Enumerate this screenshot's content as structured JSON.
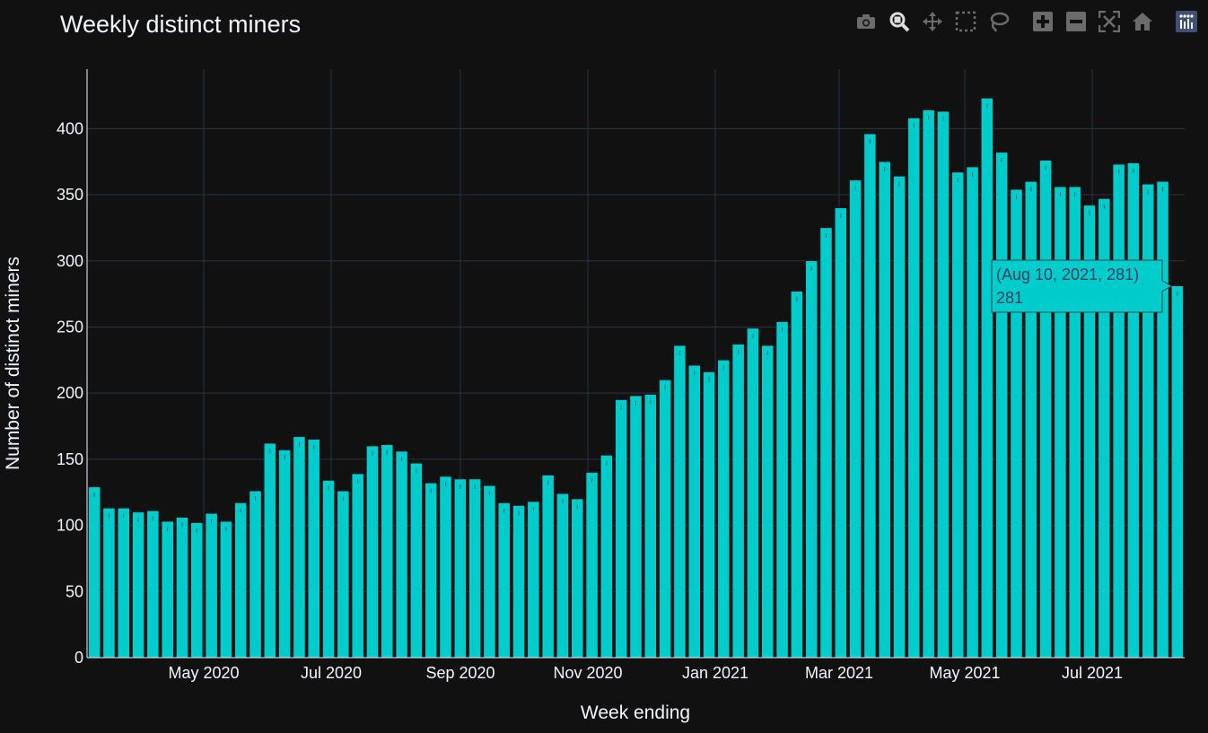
{
  "chart_data": {
    "type": "bar",
    "title": "Weekly distinct miners",
    "xlabel": "Week ending",
    "ylabel": "Number of distinct miners",
    "x_tick_labels": [
      "May 2020",
      "Jul 2020",
      "Sep 2020",
      "Nov 2020",
      "Jan 2021",
      "Mar 2021",
      "May 2021",
      "Jul 2021"
    ],
    "y_tick_labels": [
      "0",
      "50",
      "100",
      "150",
      "200",
      "250",
      "300",
      "350",
      "400"
    ],
    "ylim": [
      0,
      445
    ],
    "grid": true,
    "bar_color": "#00cccc",
    "values": [
      129,
      113,
      113,
      110,
      111,
      103,
      106,
      102,
      109,
      103,
      117,
      126,
      162,
      157,
      167,
      165,
      134,
      126,
      139,
      160,
      161,
      156,
      147,
      132,
      137,
      135,
      135,
      130,
      117,
      115,
      118,
      138,
      124,
      120,
      140,
      153,
      195,
      198,
      199,
      210,
      236,
      221,
      216,
      225,
      237,
      249,
      236,
      254,
      277,
      300,
      325,
      340,
      361,
      396,
      375,
      364,
      408,
      414,
      413,
      367,
      371,
      423,
      382,
      354,
      360,
      376,
      356,
      356,
      342,
      347,
      373,
      374,
      358,
      360,
      281
    ],
    "hover": {
      "label": "(Aug 10, 2021, 281)",
      "value": "281"
    }
  },
  "modebar": {
    "colors": {
      "icon": "#6b6b6b",
      "active": "#dddddd",
      "logo": "#ffffff",
      "logo_bg": "#3f4f75"
    },
    "buttons": [
      "camera-icon",
      "zoom-icon",
      "pan-icon",
      "box-select-icon",
      "lasso-icon",
      "zoom-in-icon",
      "zoom-out-icon",
      "autoscale-icon",
      "home-icon",
      "plotly-logo-icon"
    ]
  }
}
